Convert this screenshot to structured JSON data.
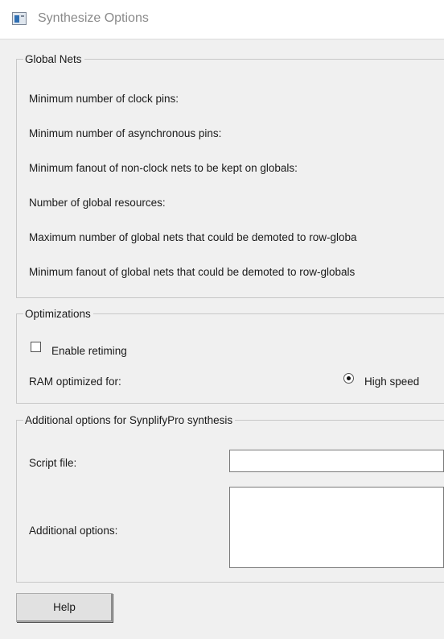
{
  "window": {
    "title": "Synthesize Options",
    "icon": "app-window-icon"
  },
  "global_nets": {
    "legend": "Global Nets",
    "labels": [
      "Minimum number of clock pins:",
      "Minimum number of asynchronous pins:",
      "Minimum fanout of non-clock nets to be kept on globals:",
      "Number of global resources:",
      "Maximum number of global nets that could be demoted to row-globa",
      "Minimum fanout of global nets that could be demoted to row-globals"
    ]
  },
  "optimizations": {
    "legend": "Optimizations",
    "enable_retiming_label": "Enable retiming",
    "enable_retiming_checked": false,
    "ram_label": "RAM optimized for:",
    "ram_option_label": "High speed",
    "ram_option_selected": true
  },
  "additional": {
    "legend": "Additional options for SynplifyPro synthesis",
    "script_file_label": "Script file:",
    "script_file_value": "",
    "additional_options_label": "Additional options:",
    "additional_options_value": ""
  },
  "buttons": {
    "help_label": "Help"
  }
}
